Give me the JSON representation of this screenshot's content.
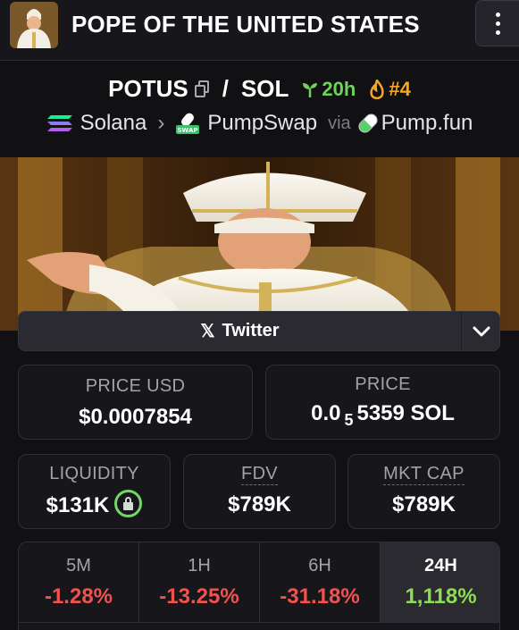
{
  "header": {
    "title": "POPE OF THE UNITED STATES",
    "avatar_icon": "token-avatar",
    "menu_icon": "more-vertical-icon"
  },
  "pair": {
    "base": "POTUS",
    "separator": "/",
    "quote": "SOL",
    "age": "20h",
    "rank": "#4"
  },
  "chain": {
    "network": "Solana",
    "dex": "PumpSwap",
    "via": "via",
    "launchpad": "Pump.fun",
    "dex_badge": "SWAP"
  },
  "social": {
    "twitter_label": "Twitter"
  },
  "metrics": {
    "price_usd_label": "PRICE USD",
    "price_usd": "$0.0007854",
    "price_label": "PRICE",
    "price_prefix": "0.0",
    "price_subscript": "5",
    "price_rest": "5359 SOL",
    "liquidity_label": "LIQUIDITY",
    "liquidity": "$131K",
    "fdv_label": "FDV",
    "fdv": "$789K",
    "mcap_label": "MKT CAP",
    "mcap": "$789K"
  },
  "changes": [
    {
      "label": "5M",
      "value": "-1.28%"
    },
    {
      "label": "1H",
      "value": "-13.25%"
    },
    {
      "label": "6H",
      "value": "-31.18%"
    },
    {
      "label": "24H",
      "value": "1,118%"
    }
  ],
  "colors": {
    "negative": "#f0524f",
    "positive": "#8ddc52",
    "age_green": "#6ed25c",
    "rank_orange": "#f5a623"
  }
}
